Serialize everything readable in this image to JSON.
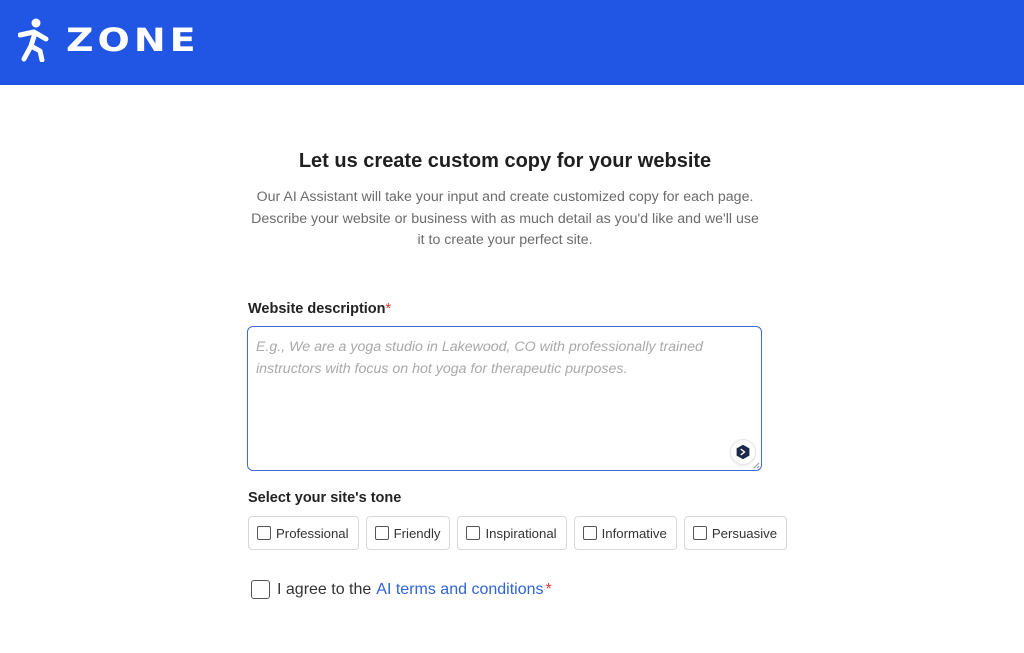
{
  "header": {
    "logo_text": "ZONE",
    "brand_color": "#2155e3"
  },
  "intro": {
    "title": "Let us create custom copy for your website",
    "subtitle": "Our AI Assistant will take your input and create customized copy for each page. Describe your website or business with as much detail as you'd like and we'll use it to create your perfect site."
  },
  "description_field": {
    "label": "Website description",
    "required_mark": "*",
    "value": "",
    "placeholder": "E.g., We are a yoga studio in Lakewood, CO with professionally trained instructors with focus on hot yoga for therapeutic purposes."
  },
  "tone": {
    "label": "Select your site's tone",
    "options": [
      {
        "label": "Professional",
        "checked": false
      },
      {
        "label": "Friendly",
        "checked": false
      },
      {
        "label": "Inspirational",
        "checked": false
      },
      {
        "label": "Informative",
        "checked": false
      },
      {
        "label": "Persuasive",
        "checked": false
      }
    ]
  },
  "agreement": {
    "prefix": "I agree to the",
    "link_text": "AI terms and conditions",
    "required_mark": "*",
    "checked": false,
    "link_color": "#2f64d6"
  },
  "icons": {
    "logo": "running-person-icon",
    "assistant": "ai-assistant-icon",
    "resize": "resize-grip-icon"
  }
}
